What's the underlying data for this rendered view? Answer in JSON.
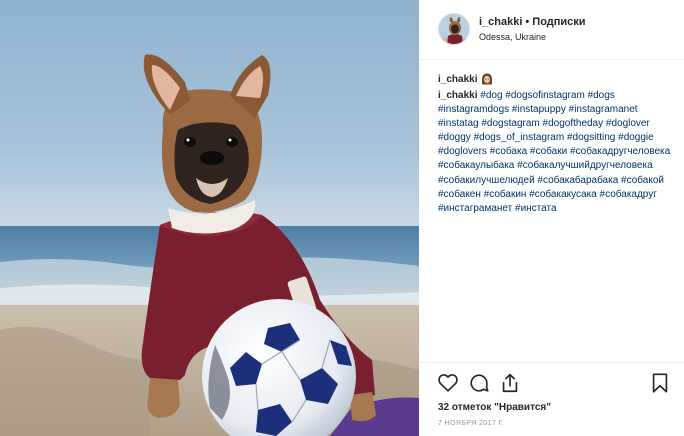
{
  "header": {
    "username": "i_chakki",
    "separator": "•",
    "follow_label": "Подписки",
    "location": "Odessa, Ukraine"
  },
  "caption": {
    "username": "i_chakki",
    "emoji": "woman-with-headscarf-emoji",
    "owner": "i_chakki",
    "hashtags": "#dog #dogsofinstagram #dogs #instagramdogs #instapuppy #instagramanet #instatag #dogstagram #dogoftheday #doglover #doggy #dogs_of_instagram #dogsitting #doggie #doglovers #собака #собаки #собакадругчеловека #собакаулыбака #собакалучшийдругчеловека #собакилучшелюдей #собакабарабака #собакой #собакен #собакин #собакакусака #собакадруг #инстаграманет #инстата"
  },
  "actions": {
    "like_icon": "heart-icon",
    "comment_icon": "comment-icon",
    "share_icon": "share-icon",
    "save_icon": "bookmark-icon"
  },
  "likes": "32 отметок \"Нравится\"",
  "date": "7 НОЯБРЯ 2017 Г.",
  "colors": {
    "hashtag": "#003569",
    "text": "#262626",
    "muted": "#999999",
    "divider": "#efefef"
  }
}
